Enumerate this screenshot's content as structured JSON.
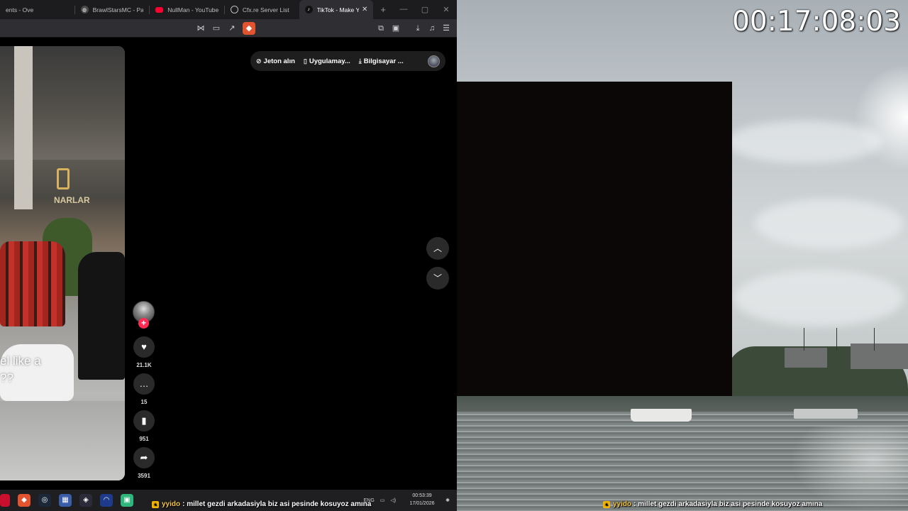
{
  "browser": {
    "tabs": [
      {
        "label": "ents - Ove",
        "icon": "document-icon",
        "color": "#3a3a3a",
        "active": false
      },
      {
        "label": "BrawlStarsMC - Paper",
        "icon": "globe-icon",
        "color": "#555555",
        "active": false
      },
      {
        "label": "NullMan - YouTube",
        "icon": "youtube-icon",
        "color": "#ff0033",
        "active": false
      },
      {
        "label": "Cfx.re Server List",
        "icon": "globe-icon",
        "color": "#555555",
        "active": false
      },
      {
        "label": "TikTok - Make You",
        "icon": "tiktok-icon",
        "color": "#111111",
        "active": true
      }
    ],
    "new_tab": "+"
  },
  "tiktok": {
    "top_bar": {
      "coins": "Jeton alın",
      "app": "Uygulamay...",
      "pc": "Bilgisayar ..."
    },
    "video_caption_line1": "el like a",
    "video_caption_line2": "??",
    "sign_text": "NARLAR",
    "actions": {
      "likes": "21.1K",
      "comments": "15",
      "saves": "951",
      "shares": "3591"
    }
  },
  "stream": {
    "timer": "00:17:08:03",
    "chat": {
      "user": "yyido",
      "message": ": millet gezdi arkadasiyla biz asi pesinde kosuyoz amına"
    }
  },
  "taskbar": {
    "lang": "ENG",
    "time": "00:53:39",
    "date": "17/01/2026"
  },
  "colors": {
    "tiktok_red": "#fe2c55",
    "chat_user": "#f5c64b"
  }
}
